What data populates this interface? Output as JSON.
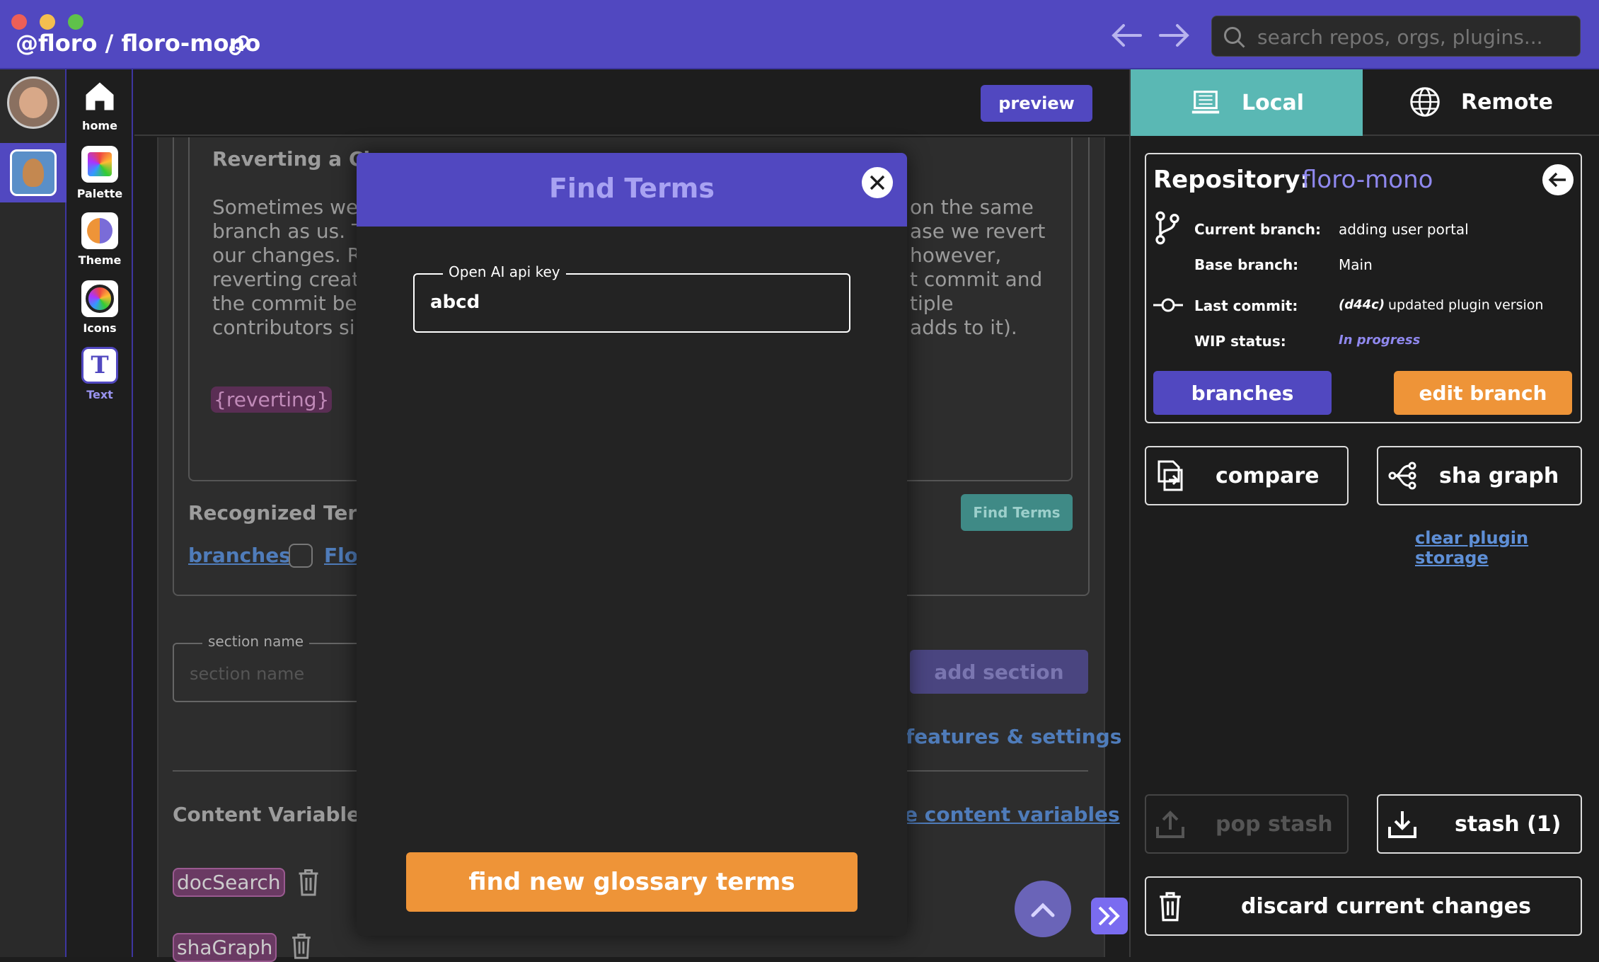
{
  "titlebar": {
    "breadcrumb": "@floro / floro-mono",
    "search_placeholder": "search repos, orgs, plugins..."
  },
  "plugins": [
    {
      "label": "home"
    },
    {
      "label": "Palette"
    },
    {
      "label": "Theme"
    },
    {
      "label": "Icons"
    },
    {
      "label": "Text"
    }
  ],
  "header": {
    "preview_label": "preview"
  },
  "background": {
    "section_title": "Reverting a Ch",
    "para_left": [
      "Sometimes we",
      "branch as us. T",
      "our changes. Re",
      "reverting create",
      "the commit bei",
      "contributors sin"
    ],
    "para_right": [
      "on the same",
      "ase we revert",
      "however,",
      "t commit and",
      "tiple",
      "adds to it)."
    ],
    "tag_reverting": "{reverting}",
    "recognized_terms": "Recognized Term",
    "term1": "branches",
    "term2": "Flo",
    "find_terms_small": "Find Terms",
    "section_name_label": "section name",
    "section_name_placeholder": "section name",
    "add_section": "add section",
    "features_link": "features & settings",
    "content_variables": "Content Variables",
    "content_variables_link": "e content variables",
    "var1": "docSearch",
    "var2": "shaGraph"
  },
  "modal": {
    "title": "Find Terms",
    "field_label": "Open AI api key",
    "field_value": "abcd",
    "action": "find new glossary terms"
  },
  "right": {
    "tab_local": "Local",
    "tab_remote": "Remote",
    "repo_label": "Repository:",
    "repo_name": "floro-mono",
    "current_branch_label": "Current branch:",
    "current_branch": "adding user portal",
    "base_branch_label": "Base branch:",
    "base_branch": "Main",
    "last_commit_label": "Last commit:",
    "last_commit_sha": "(d44c)",
    "last_commit_msg": "updated plugin version",
    "wip_label": "WIP status:",
    "wip_value": "In progress",
    "branches_btn": "branches",
    "edit_branch_btn": "edit branch",
    "compare_btn": "compare",
    "sha_graph_btn": "sha graph",
    "clear_storage": "clear plugin storage",
    "pop_stash": "pop stash",
    "stash": "stash (1)",
    "discard": "discard current changes"
  },
  "colors": {
    "accent": "#5148c0",
    "orange": "#ee9438",
    "teal": "#5ab8b4",
    "link": "#5e8fd6"
  }
}
